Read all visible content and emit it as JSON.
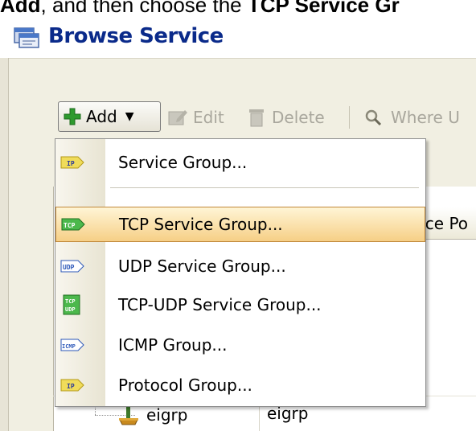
{
  "caption": {
    "prefix_bold": "Add",
    "middle": ", and then choose the ",
    "suffix_bold": "TCP Service Gr"
  },
  "window": {
    "title": "Browse Service",
    "title_icon": "browse-service-icon"
  },
  "toolbar": {
    "add_label": "Add",
    "edit_label": "Edit",
    "delete_label": "Delete",
    "where_used_label": "Where U"
  },
  "table": {
    "partial_column_header": "rce Po",
    "rows": [
      {
        "name": "eigrp",
        "value": "eigrp",
        "icon": "eigrp-protocol-icon"
      }
    ]
  },
  "add_menu": {
    "items": [
      {
        "label": "Service Group...",
        "icon_text": "IP",
        "icon_color": "#e8d24a",
        "highlighted": false
      },
      {
        "label": "TCP Service Group...",
        "icon_text": "TCP",
        "icon_color": "#3aa53a",
        "highlighted": true
      },
      {
        "label": "UDP Service Group...",
        "icon_text": "UDP",
        "icon_color": "#2b57b8",
        "highlighted": false
      },
      {
        "label": "TCP-UDP Service Group...",
        "icon_text": "TCP UDP",
        "icon_color": "#3aa53a",
        "highlighted": false
      },
      {
        "label": "ICMP Group...",
        "icon_text": "ICMP",
        "icon_color": "#2b57b8",
        "highlighted": false
      },
      {
        "label": "Protocol Group...",
        "icon_text": "IP",
        "icon_color": "#e8d24a",
        "highlighted": false
      }
    ]
  },
  "colors": {
    "title_text": "#0a2a8a",
    "highlight_top": "#fff5d6",
    "highlight_bottom": "#f6cf86",
    "add_icon_green": "#2e9a2e"
  }
}
